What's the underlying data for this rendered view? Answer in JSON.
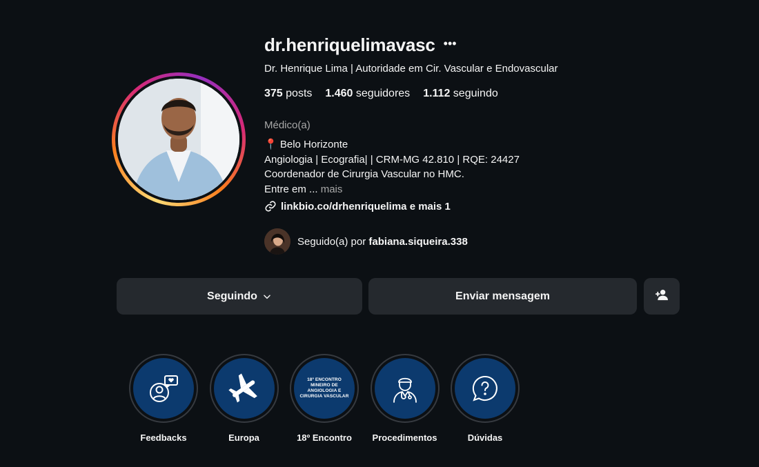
{
  "profile": {
    "username": "dr.henriquelimavasc",
    "more_icon": "ellipsis-icon",
    "full_name": "Dr. Henrique Lima | Autoridade em Cir. Vascular e Endovascular",
    "stats": {
      "posts_count": "375",
      "posts_label": "posts",
      "followers_count": "1.460",
      "followers_label": "seguidores",
      "following_count": "1.112",
      "following_label": "seguindo"
    },
    "category": "Médico(a)",
    "bio": {
      "line1_icon": "📍",
      "line1": "Belo Horizonte",
      "line2": "Angiologia | Ecografia| | CRM-MG 42.810 | RQE: 24427",
      "line3": "Coordenador de Cirurgia Vascular no HMC.",
      "line4": "Entre em ...",
      "more": "mais"
    },
    "link": {
      "icon": "link-icon",
      "text": "linkbio.co/drhenriquelima e mais 1"
    },
    "followed_by": {
      "prefix": "Seguido(a) por",
      "user": "fabiana.siqueira.338"
    }
  },
  "actions": {
    "following_label": "Seguindo",
    "message_label": "Enviar mensagem",
    "add_user_icon": "add-person-icon"
  },
  "highlights": [
    {
      "label": "Feedbacks",
      "icon": "person-heart-chat-icon"
    },
    {
      "label": "Europa",
      "icon": "airplane-icon"
    },
    {
      "label": "18º Encontro",
      "cover_text": [
        "18º ENCONTRO",
        "MINEIRO DE",
        "ANGIOLOGIA E",
        "CIRURGIA VASCULAR"
      ]
    },
    {
      "label": "Procedimentos",
      "icon": "doctor-icon"
    },
    {
      "label": "Dúvidas",
      "icon": "question-chat-icon"
    }
  ],
  "colors": {
    "background": "#0c1014",
    "button": "#25292e",
    "highlight_fill": "#0c3a6e",
    "muted_text": "#a8a8a8"
  }
}
